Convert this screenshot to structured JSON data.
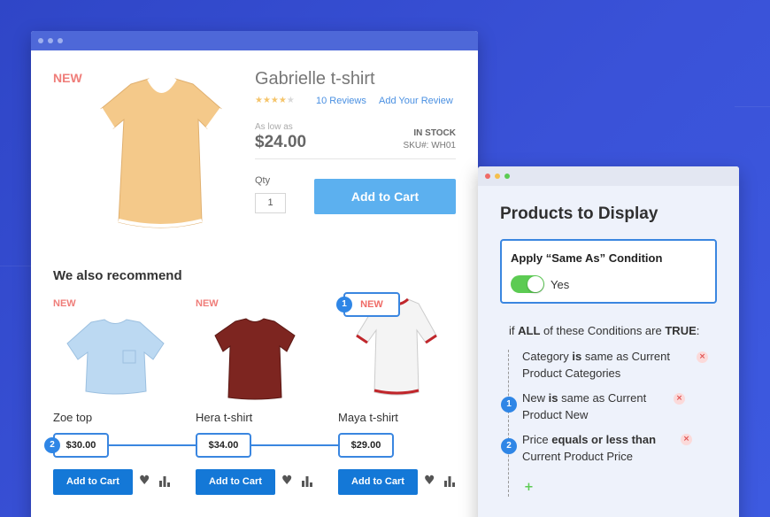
{
  "product": {
    "new_tag": "NEW",
    "title": "Gabrielle t-shirt",
    "rating": 4,
    "rating_max": 5,
    "reviews_link": "10 Reviews",
    "add_review_link": "Add Your Review",
    "as_low_as": "As low as",
    "price": "$24.00",
    "stock": "IN STOCK",
    "sku": "SKU#: WH01",
    "qty_label": "Qty",
    "qty_value": "1",
    "add_to_cart": "Add to Cart"
  },
  "recommend": {
    "title": "We also recommend",
    "items": [
      {
        "new_tag": "NEW",
        "name": "Zoe top",
        "price": "$30.00",
        "button": "Add to Cart"
      },
      {
        "new_tag": "NEW",
        "name": "Hera t-shirt",
        "price": "$34.00",
        "button": "Add to Cart"
      },
      {
        "new_tag": "NEW",
        "name": "Maya t-shirt",
        "price": "$29.00",
        "button": "Add to Cart"
      }
    ],
    "markers": [
      "1",
      "2"
    ]
  },
  "panel": {
    "title": "Products to Display",
    "condition_box_title": "Apply “Same As” Condition",
    "toggle_label": "Yes",
    "toggle_on": true,
    "if_prefix": "if",
    "if_all": "ALL",
    "if_middle": "of these Conditions are",
    "if_true": "TRUE",
    "if_suffix": ":",
    "conditions": [
      {
        "marker": "",
        "a": "Category",
        "op": "is",
        "b": "same as Current",
        "c": "Product Categories"
      },
      {
        "marker": "1",
        "a": "New",
        "op": "is",
        "b": "same as Current",
        "c": "Product New"
      },
      {
        "marker": "2",
        "a": "Price",
        "op": "equals or less than",
        "b": "",
        "c": "Current Product Price"
      }
    ],
    "add_symbol": "+",
    "remove_symbol": "×"
  },
  "colors": {
    "background": "#3a52d8",
    "accent": "#3a86e0",
    "new_tag": "#ef7d79",
    "main_button": "#5cb0ef",
    "small_button": "#1478d7",
    "toggle": "#5ccb53"
  },
  "icons": [
    "heart-icon",
    "compare-icon",
    "remove-icon",
    "add-icon"
  ]
}
